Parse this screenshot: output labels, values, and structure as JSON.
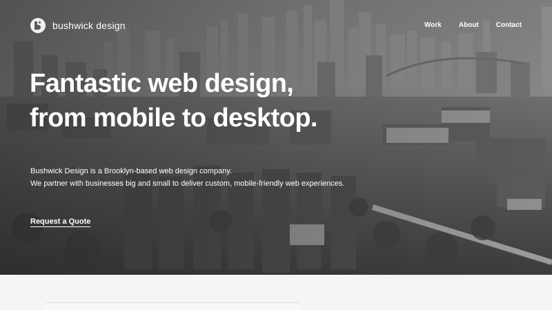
{
  "brand": {
    "name": "bushwick design",
    "logo_icon": "bushwick-logo-mark"
  },
  "nav": {
    "items": [
      "Work",
      "About",
      "Contact"
    ]
  },
  "hero": {
    "headline_line1": "Fantastic web design,",
    "headline_line2": "from mobile to desktop.",
    "intro_line1": "Bushwick Design is a Brooklyn-based web design company.",
    "intro_line2": "We partner with businesses big and small to deliver custom, mobile-friendly web experiences.",
    "cta_label": "Request a Quote",
    "background_image": "grayscale aerial view of Brooklyn with Manhattan skyline"
  },
  "colors": {
    "hero_text": "#ffffff",
    "lower_bg": "#f5f5f5"
  }
}
